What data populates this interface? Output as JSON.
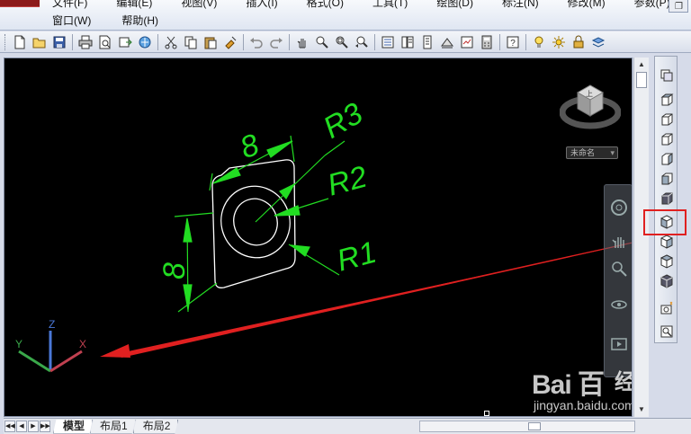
{
  "menus": {
    "row1": [
      "文件(F)",
      "编辑(E)",
      "视图(V)",
      "插入(I)",
      "格式(O)",
      "工具(T)",
      "绘图(D)",
      "标注(N)",
      "修改(M)",
      "参数(P)"
    ],
    "row2": [
      "窗口(W)",
      "帮助(H)"
    ]
  },
  "toolbar_icons": [
    "new-icon",
    "open-icon",
    "save-icon",
    "print-icon",
    "print-preview-icon",
    "publish-icon",
    "plot-3d-icon",
    "cut-icon",
    "copy-icon",
    "paste-icon",
    "match-properties-icon",
    "block-editor-icon",
    "undo-icon",
    "redo-icon",
    "pan-icon",
    "zoom-realtime-icon",
    "zoom-window-icon",
    "zoom-previous-icon",
    "properties-icon",
    "design-center-icon",
    "tool-palettes-icon",
    "sheet-set-icon",
    "markup-icon",
    "quickcalc-icon",
    "help-icon",
    "light-icon",
    "sun-icon",
    "lock-icon",
    "layer-icon"
  ],
  "drawing": {
    "dims": [
      "8",
      "8"
    ],
    "radius_labels": [
      "R3",
      "R2",
      "R1"
    ],
    "ucs": {
      "x_label": "X",
      "y_label": "Y",
      "z_label": "Z"
    }
  },
  "viewcube": {
    "face_label": "上",
    "wcs_label": "未命名"
  },
  "right_toolbar": [
    "named-views-icon",
    "top-view-icon",
    "bottom-view-icon",
    "left-view-icon",
    "right-view-icon",
    "front-view-icon",
    "back-view-icon",
    "sw-iso-view-icon",
    "se-iso-view-icon",
    "ne-iso-view-icon",
    "nw-iso-view-icon",
    "new-camera-icon",
    "zoom-camera-icon"
  ],
  "tabs": {
    "nav": [
      "◀◀",
      "◀",
      "▶",
      "▶▶"
    ],
    "items": [
      "模型",
      "布局1",
      "布局2"
    ]
  },
  "watermark": {
    "logo": "Bai 百",
    "brand": "经验",
    "url": "jingyan.baidu.com"
  },
  "colors": {
    "accent_red": "#e02020",
    "dim_green": "#22dd22",
    "geometry_white": "#ffffff"
  }
}
